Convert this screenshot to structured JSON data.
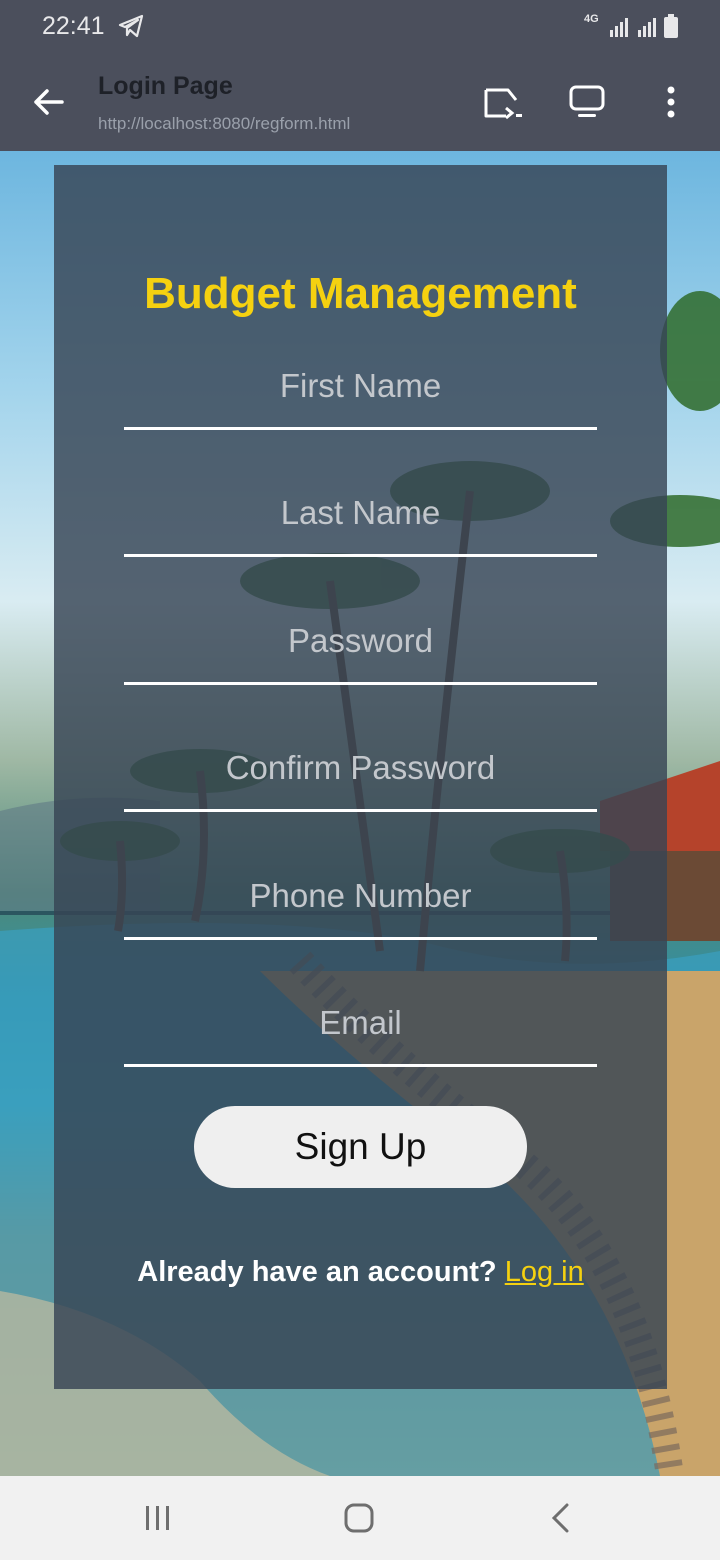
{
  "status_bar": {
    "time": "22:41",
    "network": "4G"
  },
  "browser": {
    "title": "Login Page",
    "url": "http://localhost:8080/regform.html"
  },
  "form": {
    "title": "Budget Management",
    "fields": [
      {
        "placeholder": "First Name"
      },
      {
        "placeholder": "Last Name"
      },
      {
        "placeholder": "Password"
      },
      {
        "placeholder": "Confirm Password"
      },
      {
        "placeholder": "Phone Number"
      },
      {
        "placeholder": "Email"
      }
    ],
    "submit_label": "Sign Up",
    "login_prompt": "Already have an account?",
    "login_link": "Log in"
  },
  "colors": {
    "accent": "#f5d110",
    "card": "#374454",
    "chrome": "#4b4f5c"
  },
  "icons": [
    "telegram-icon",
    "signal-icon",
    "battery-icon",
    "back-arrow-icon",
    "cast-icon",
    "desktop-icon",
    "more-icon",
    "recent-apps-icon",
    "home-icon",
    "nav-back-icon"
  ]
}
